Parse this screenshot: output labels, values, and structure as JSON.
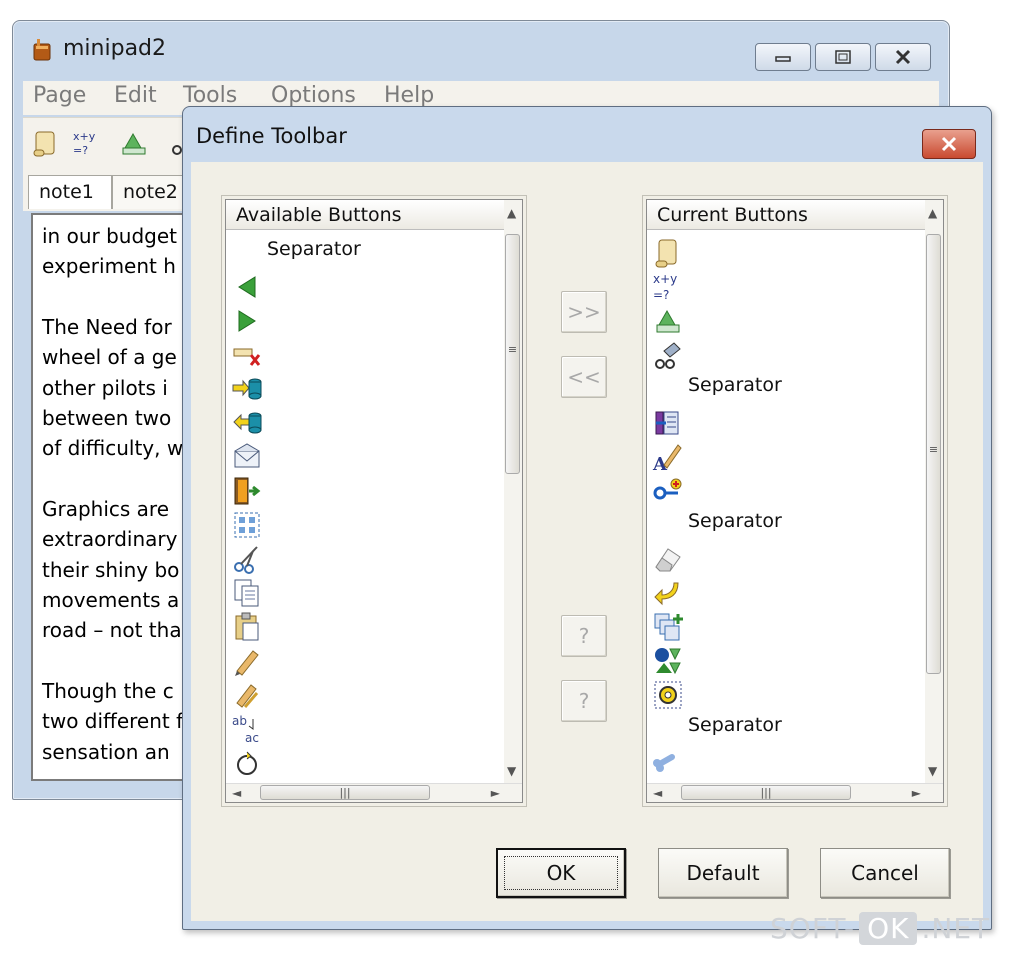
{
  "main_window": {
    "title": "minipad2",
    "menu": [
      "Page",
      "Edit",
      "Tools",
      "Options",
      "Help"
    ],
    "tabs": [
      "note1",
      "note2"
    ],
    "text_lines": [
      "in our budget",
      "experiment h",
      "",
      "The Need for",
      "wheel of a ge",
      "other pilots i",
      "between two",
      "of difficulty, w",
      "",
      "Graphics are",
      "extraordinary",
      "their shiny bo",
      "movements a",
      "road – not tha",
      "",
      "Though the c",
      "two different f",
      "sensation an"
    ]
  },
  "dialog": {
    "title": "Define Toolbar",
    "available": {
      "header": "Available Buttons",
      "items": [
        {
          "icon": "separator",
          "label": "Separator"
        },
        {
          "icon": "back-arrow-icon",
          "label": ""
        },
        {
          "icon": "forward-arrow-icon",
          "label": ""
        },
        {
          "icon": "delete-tab-icon",
          "label": ""
        },
        {
          "icon": "import-db-icon",
          "label": ""
        },
        {
          "icon": "export-db-icon",
          "label": ""
        },
        {
          "icon": "mail-icon",
          "label": ""
        },
        {
          "icon": "exit-door-icon",
          "label": ""
        },
        {
          "icon": "select-grid-icon",
          "label": ""
        },
        {
          "icon": "cut-icon",
          "label": ""
        },
        {
          "icon": "copy-icon",
          "label": ""
        },
        {
          "icon": "paste-icon",
          "label": ""
        },
        {
          "icon": "pencil-icon",
          "label": ""
        },
        {
          "icon": "pencil-swap-icon",
          "label": ""
        },
        {
          "icon": "replace-text-icon",
          "label": ""
        },
        {
          "icon": "refresh-icon",
          "label": ""
        }
      ]
    },
    "current": {
      "header": "Current Buttons",
      "items": [
        {
          "icon": "scroll-icon",
          "label": ""
        },
        {
          "icon": "calculator-icon",
          "label": ""
        },
        {
          "icon": "recycle-icon",
          "label": ""
        },
        {
          "icon": "search-glasses-icon",
          "label": ""
        },
        {
          "icon": "separator",
          "label": "Separator"
        },
        {
          "icon": "columns-icon",
          "label": ""
        },
        {
          "icon": "font-pen-icon",
          "label": ""
        },
        {
          "icon": "key-add-icon",
          "label": ""
        },
        {
          "icon": "separator",
          "label": "Separator"
        },
        {
          "icon": "eraser-icon",
          "label": ""
        },
        {
          "icon": "undo-arrow-icon",
          "label": ""
        },
        {
          "icon": "add-page-icon",
          "label": ""
        },
        {
          "icon": "shapes-icon",
          "label": ""
        },
        {
          "icon": "settings-gear-icon",
          "label": ""
        },
        {
          "icon": "separator",
          "label": "Separator"
        },
        {
          "icon": "bone-icon",
          "label": ""
        }
      ]
    },
    "add_label": ">>",
    "remove_label": "<<",
    "move_up_label": "?",
    "move_down_label": "?",
    "ok_label": "OK",
    "default_label": "Default",
    "cancel_label": "Cancel"
  },
  "watermark": {
    "prefix": "SOFT-",
    "mid": "OK",
    "suffix": ".NET"
  }
}
